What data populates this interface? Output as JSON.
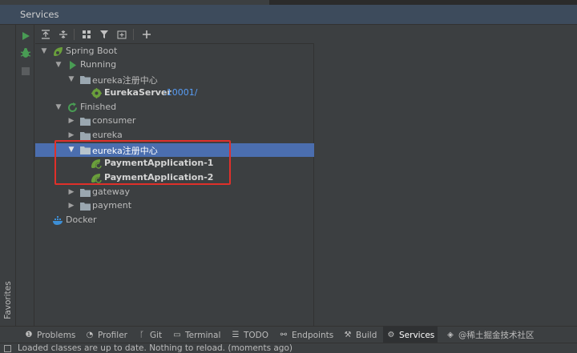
{
  "panel": {
    "title": "Services"
  },
  "favorites": {
    "label": "Favorites"
  },
  "tree": {
    "spring_boot": "Spring Boot",
    "running": "Running",
    "running_group": "eureka注册中心",
    "eureka_server": {
      "name": "EurekaServer",
      "port": ":10001/"
    },
    "finished": "Finished",
    "consumer": "consumer",
    "eureka": "eureka",
    "selected_group": "eureka注册中心",
    "payment1": "PaymentApplication-1",
    "payment2": "PaymentApplication-2",
    "gateway": "gateway",
    "payment": "payment",
    "docker": "Docker"
  },
  "toolwindows": [
    {
      "label": "Problems",
      "icon": "problems-icon"
    },
    {
      "label": "Profiler",
      "icon": "profiler-icon"
    },
    {
      "label": "Git",
      "icon": "git-icon"
    },
    {
      "label": "Terminal",
      "icon": "terminal-icon"
    },
    {
      "label": "TODO",
      "icon": "todo-icon"
    },
    {
      "label": "Endpoints",
      "icon": "endpoints-icon"
    },
    {
      "label": "Build",
      "icon": "build-icon"
    },
    {
      "label": "Services",
      "icon": "services-icon"
    },
    {
      "label": "@稀土掘金技术社区",
      "icon": "database-icon"
    }
  ],
  "status": {
    "message": "Loaded classes are up to date. Nothing to reload. (moments ago)"
  },
  "colors": {
    "selection": "#4b6eaf",
    "highlight_box": "#e0302a",
    "port_link": "#589df6",
    "run_green": "#499c54"
  }
}
